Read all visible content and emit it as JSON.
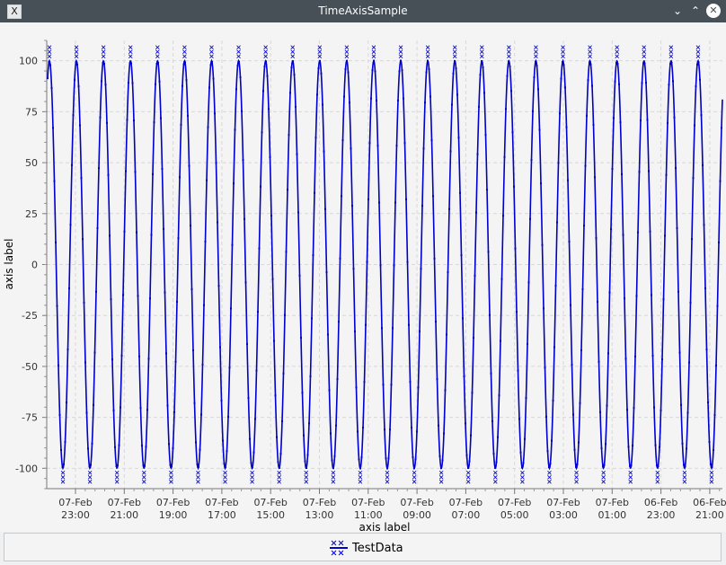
{
  "window": {
    "title": "TimeAxisSample",
    "icon": "x11-app-icon",
    "buttons": [
      "minimize-icon",
      "maximize-icon",
      "close-icon"
    ]
  },
  "legend": {
    "entries": [
      {
        "label": "TestData",
        "color": "#0000cc",
        "marker": "x"
      }
    ]
  },
  "chart_data": {
    "type": "line",
    "xlabel": "axis label",
    "ylabel": "axis label",
    "ylim": [
      -110,
      110
    ],
    "x_axis": "time (inverted: newer on left)",
    "y_ticks": [
      100,
      75,
      50,
      25,
      0,
      -25,
      -50,
      -75,
      -100
    ],
    "x_ticks": [
      {
        "date": "07-Feb",
        "time": "23:00"
      },
      {
        "date": "07-Feb",
        "time": "21:00"
      },
      {
        "date": "07-Feb",
        "time": "19:00"
      },
      {
        "date": "07-Feb",
        "time": "17:00"
      },
      {
        "date": "07-Feb",
        "time": "15:00"
      },
      {
        "date": "07-Feb",
        "time": "13:00"
      },
      {
        "date": "07-Feb",
        "time": "11:00"
      },
      {
        "date": "07-Feb",
        "time": "09:00"
      },
      {
        "date": "07-Feb",
        "time": "07:00"
      },
      {
        "date": "07-Feb",
        "time": "05:00"
      },
      {
        "date": "07-Feb",
        "time": "03:00"
      },
      {
        "date": "07-Feb",
        "time": "01:00"
      },
      {
        "date": "06-Feb",
        "time": "23:00"
      },
      {
        "date": "06-Feb",
        "time": "21:00"
      }
    ],
    "series": [
      {
        "name": "TestData",
        "color": "#0000cc",
        "shape": "sine",
        "amplitude": 100,
        "cycles": 25
      }
    ],
    "grid": true,
    "legend_position": "bottom"
  }
}
